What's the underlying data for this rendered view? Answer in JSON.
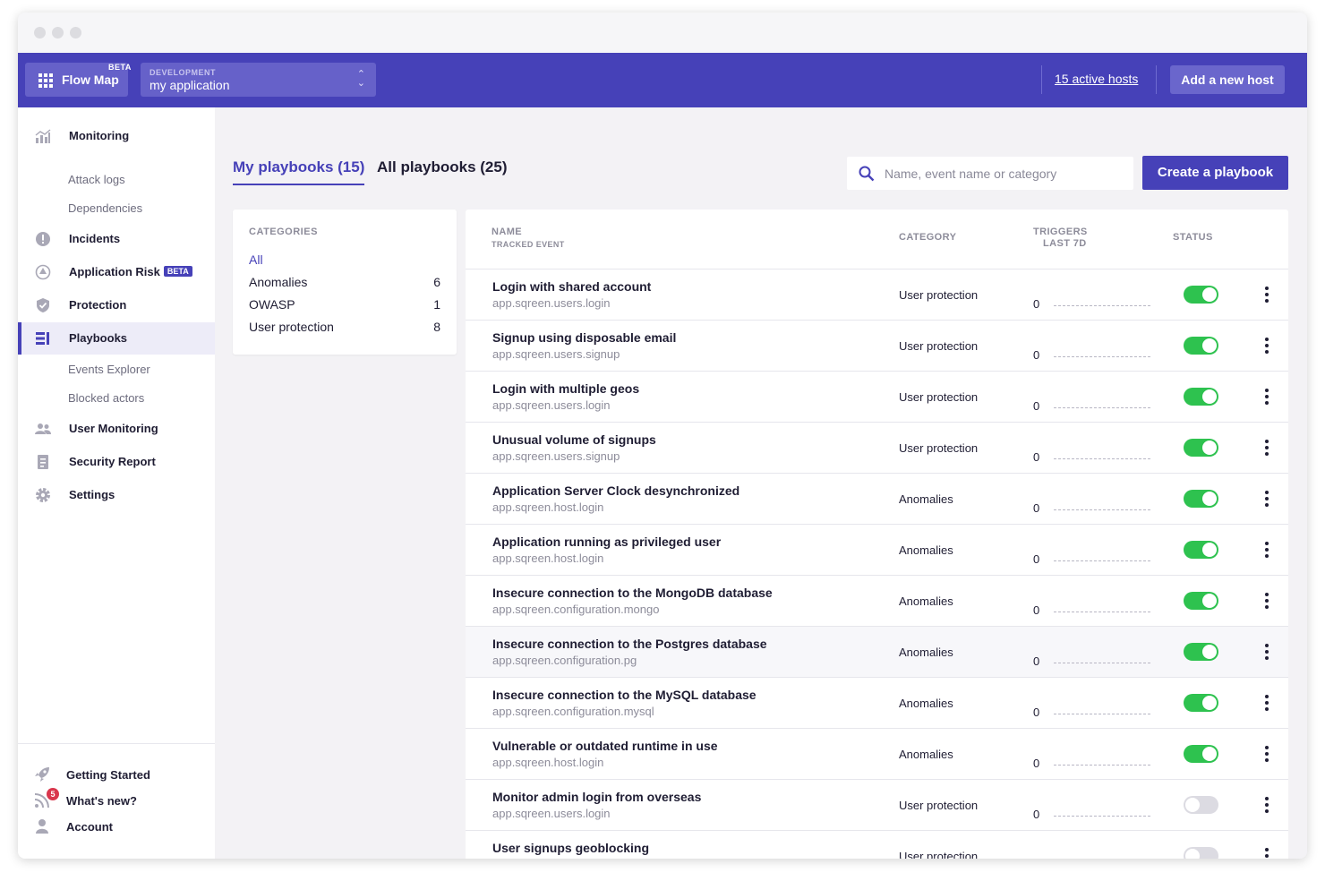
{
  "topbar": {
    "flowmap_label": "Flow Map",
    "flowmap_badge": "BETA",
    "env_label": "DEVELOPMENT",
    "app_name": "my application",
    "active_hosts": "15 active hosts",
    "add_host": "Add a new host"
  },
  "sidebar": {
    "items": [
      {
        "label": "Monitoring",
        "icon": "chart-icon"
      },
      {
        "label": "Attack logs"
      },
      {
        "label": "Dependencies"
      },
      {
        "label": "Incidents",
        "icon": "alert-icon"
      },
      {
        "label": "Application Risk",
        "icon": "risk-icon",
        "badge": "BETA"
      },
      {
        "label": "Protection",
        "icon": "shield-icon"
      },
      {
        "label": "Playbooks",
        "icon": "playbook-icon",
        "active": true
      },
      {
        "label": "Events Explorer"
      },
      {
        "label": "Blocked actors"
      },
      {
        "label": "User Monitoring",
        "icon": "users-icon"
      },
      {
        "label": "Security Report",
        "icon": "report-icon"
      },
      {
        "label": "Settings",
        "icon": "gear-icon"
      }
    ],
    "footer": [
      {
        "label": "Getting Started",
        "icon": "rocket-icon"
      },
      {
        "label": "What's new?",
        "icon": "rss-icon",
        "badge": "5"
      },
      {
        "label": "Account",
        "icon": "person-icon"
      }
    ]
  },
  "tabs": {
    "mine": "My playbooks (15)",
    "all": "All playbooks (25)"
  },
  "search": {
    "placeholder": "Name, event name or category"
  },
  "create_label": "Create a playbook",
  "categories": {
    "heading": "CATEGORIES",
    "items": [
      {
        "name": "All",
        "count": ""
      },
      {
        "name": "Anomalies",
        "count": "6"
      },
      {
        "name": "OWASP",
        "count": "1"
      },
      {
        "name": "User protection",
        "count": "8"
      }
    ]
  },
  "table": {
    "headers": {
      "name": "NAME",
      "event": "TRACKED EVENT",
      "category": "CATEGORY",
      "triggers": "TRIGGERS",
      "last7d": "LAST 7D",
      "status": "STATUS"
    },
    "rows": [
      {
        "name": "Login with shared account",
        "event": "app.sqreen.users.login",
        "category": "User protection",
        "triggers": "0",
        "enabled": true
      },
      {
        "name": "Signup using disposable email",
        "event": "app.sqreen.users.signup",
        "category": "User protection",
        "triggers": "0",
        "enabled": true
      },
      {
        "name": "Login with multiple geos",
        "event": "app.sqreen.users.login",
        "category": "User protection",
        "triggers": "0",
        "enabled": true
      },
      {
        "name": "Unusual volume of signups",
        "event": "app.sqreen.users.signup",
        "category": "User protection",
        "triggers": "0",
        "enabled": true
      },
      {
        "name": "Application Server Clock desynchronized",
        "event": "app.sqreen.host.login",
        "category": "Anomalies",
        "triggers": "0",
        "enabled": true
      },
      {
        "name": "Application running as privileged user",
        "event": "app.sqreen.host.login",
        "category": "Anomalies",
        "triggers": "0",
        "enabled": true
      },
      {
        "name": "Insecure connection to the MongoDB database",
        "event": "app.sqreen.configuration.mongo",
        "category": "Anomalies",
        "triggers": "0",
        "enabled": true
      },
      {
        "name": "Insecure connection to the Postgres database",
        "event": "app.sqreen.configuration.pg",
        "category": "Anomalies",
        "triggers": "0",
        "enabled": true
      },
      {
        "name": "Insecure connection to the MySQL database",
        "event": "app.sqreen.configuration.mysql",
        "category": "Anomalies",
        "triggers": "0",
        "enabled": true
      },
      {
        "name": "Vulnerable or outdated runtime in use",
        "event": "app.sqreen.host.login",
        "category": "Anomalies",
        "triggers": "0",
        "enabled": true
      },
      {
        "name": "Monitor admin login from overseas",
        "event": "app.sqreen.users.login",
        "category": "User protection",
        "triggers": "0",
        "enabled": false
      },
      {
        "name": "User signups geoblocking",
        "event": "",
        "category": "User protection",
        "triggers": "",
        "enabled": false
      }
    ]
  },
  "colors": {
    "accent": "#4641b8",
    "toggle_on": "#2ec24f",
    "toggle_off": "#dcdbe2"
  }
}
